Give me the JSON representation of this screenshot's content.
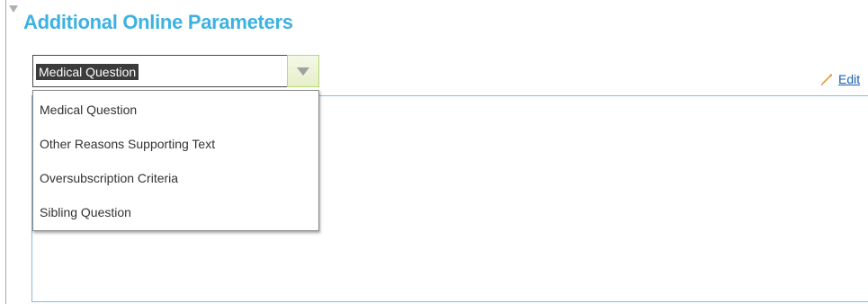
{
  "section": {
    "title": "Additional Online Parameters"
  },
  "select": {
    "selected_value": "Medical Question",
    "options": [
      "Medical Question",
      "Other Reasons Supporting Text",
      "Oversubscription Criteria",
      "Sibling Question"
    ]
  },
  "edit": {
    "label": "Edit",
    "icon": "pencil-icon"
  },
  "colors": {
    "title": "#3db1e2",
    "panel_border": "#8fb5dd",
    "link": "#1a5fb4",
    "selected_bg": "#3b3b3b",
    "dropdown_button_border": "#b6d96e"
  }
}
